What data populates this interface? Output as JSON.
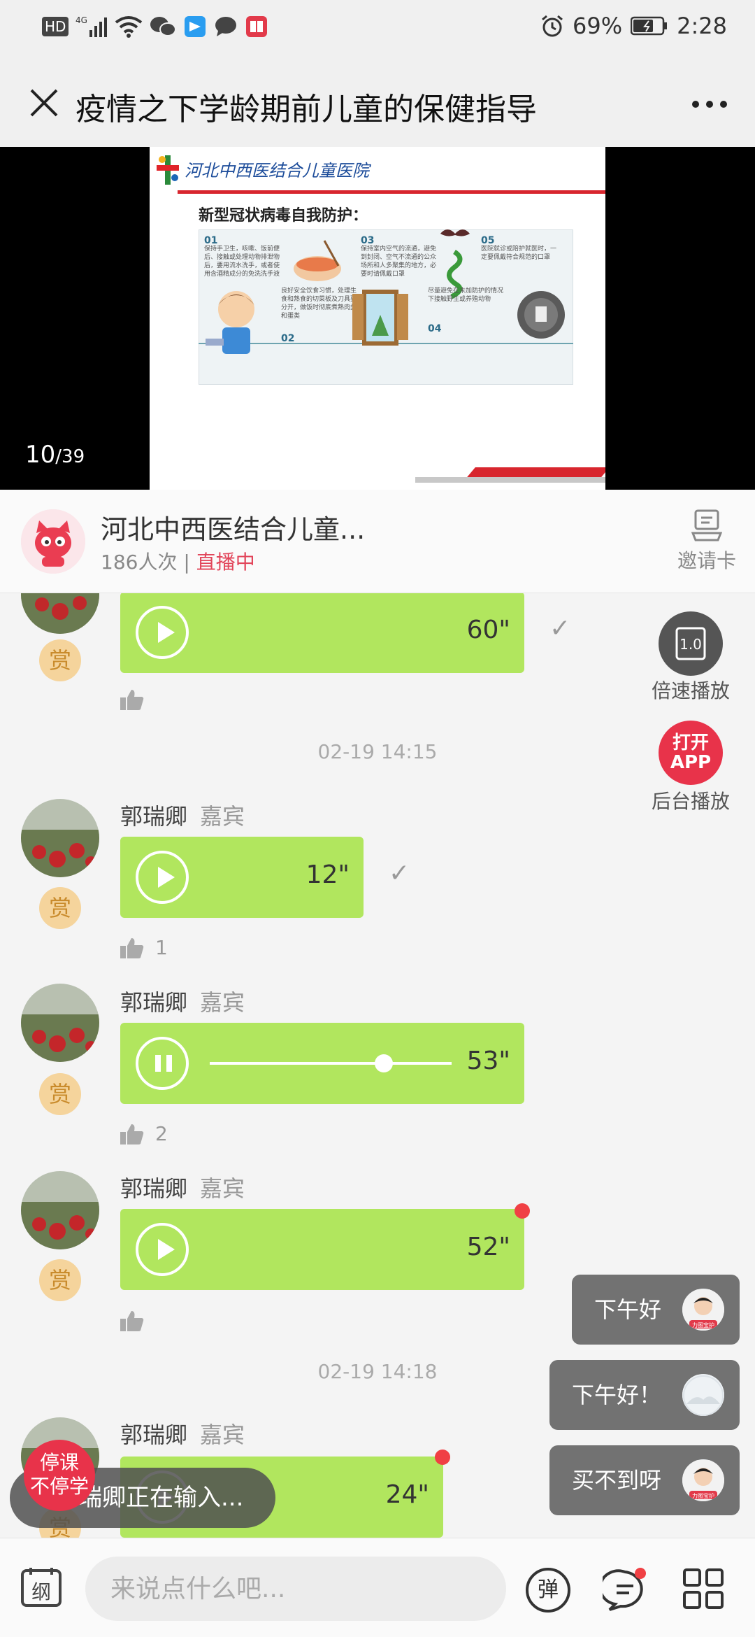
{
  "status_bar": {
    "network": "HD",
    "signal": "4G",
    "alarm_icon": "alarm-clock-icon",
    "battery": "69%",
    "time": "2:28"
  },
  "title_bar": {
    "title": "疫情之下学龄期前儿童的保健指导"
  },
  "video": {
    "slide_org": "河北中西医结合儿童医院",
    "slide_heading": "新型冠状病毒自我防护：",
    "slide_cells": [
      {
        "num": "01",
        "text": "保持手卫生，咳嗽、饭前便后、接触或处理动物排泄物后，要用流水洗手，或者使用含酒精成分的免洗洗手液"
      },
      {
        "num": "03",
        "text": "保持室内空气的流通，避免到封闭、空气不流通的公众场所和人多聚集的地方，必要时请佩戴口罩"
      },
      {
        "num": "05",
        "text": "医院就诊或陪护就医时，一定要佩戴符合规范的口罩"
      },
      {
        "num": "02",
        "text": "良好安全饮食习惯，处理生食和熟食的切菜板及刀具要分开，做饭时彻底煮熟肉类和蛋类"
      },
      {
        "num": "04",
        "text": "尽量避免在未加防护的情况下接触野生或养殖动物"
      }
    ],
    "page_current": "10",
    "page_total": "/39"
  },
  "host": {
    "name": "河北中西医结合儿童...",
    "viewers": "186人次",
    "separator": " | ",
    "status": "直播中",
    "invite_label": "邀请卡"
  },
  "messages": [
    {
      "type": "voice",
      "duration": "60\"",
      "sent_check": true,
      "likes": ""
    },
    {
      "type": "timestamp",
      "text": "02-19 14:15"
    },
    {
      "type": "voice",
      "sender": "郭瑞卿",
      "role": "嘉宾",
      "duration": "12\"",
      "sent_check": true,
      "likes": "1"
    },
    {
      "type": "voice",
      "sender": "郭瑞卿",
      "role": "嘉宾",
      "duration": "53\"",
      "playing": true,
      "progress": 0.72,
      "likes": "2"
    },
    {
      "type": "voice",
      "sender": "郭瑞卿",
      "role": "嘉宾",
      "duration": "52\"",
      "unread": true,
      "likes": ""
    },
    {
      "type": "timestamp",
      "text": "02-19 14:18"
    },
    {
      "type": "voice",
      "sender": "郭瑞卿",
      "role": "嘉宾",
      "duration": "24\"",
      "unread": true
    }
  ],
  "tip_badge": "赏",
  "side_controls": {
    "speed_value": "1.0",
    "speed_label": "倍速播放",
    "open_app_line1": "打开",
    "open_app_line2": "APP",
    "bg_play_label": "后台播放"
  },
  "floating_comments": [
    {
      "text": "下午好"
    },
    {
      "text": "下午好！"
    },
    {
      "text": "买不到呀"
    }
  ],
  "floating_avatar_caption": "力图宝护",
  "typing": {
    "text": "郭瑞卿正在输入...",
    "badge_line1": "停课",
    "badge_line2": "不停学"
  },
  "bottom_bar": {
    "outline_label": "纲",
    "input_placeholder": "来说点什么吧...",
    "danmu_label": "弹"
  },
  "colors": {
    "voice_bubble": "#b1e65e",
    "live_red": "#e2455a",
    "tip_badge": "#f5d49c",
    "unread_dot": "#f04044"
  }
}
